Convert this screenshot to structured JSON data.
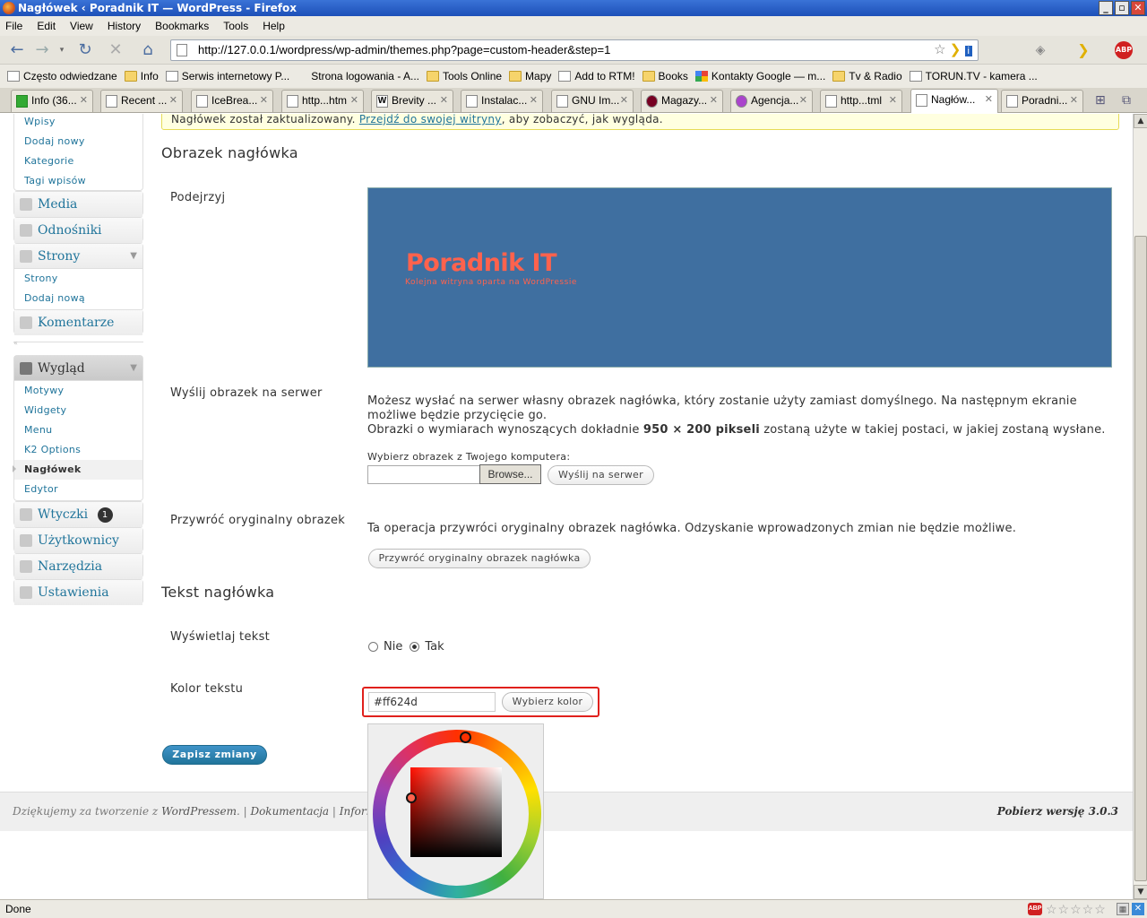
{
  "window": {
    "title": "Nagłówek ‹ Poradnik IT — WordPress - Firefox"
  },
  "menubar": [
    "File",
    "Edit",
    "View",
    "History",
    "Bookmarks",
    "Tools",
    "Help"
  ],
  "address": {
    "url": "http://127.0.0.1/wordpress/wp-admin/themes.php?page=custom-header&step=1"
  },
  "bookmarks": [
    "Często odwiedzane",
    "Info",
    "Serwis internetowy P...",
    "Strona logowania - A...",
    "Tools Online",
    "Mapy",
    "Add to RTM!",
    "Books",
    "Kontakty Google — m...",
    "Tv & Radio",
    "TORUN.TV - kamera ..."
  ],
  "tabs": [
    "Info (36...",
    "Recent ...",
    "IceBrea...",
    "http...htm",
    "Brevity ...",
    "Instalac...",
    "GNU Im...",
    "Magazy...",
    "Agencja...",
    "http...tml",
    "Nagłów...",
    "Poradni..."
  ],
  "notice": {
    "text": "Nagłówek został zaktualizowany.",
    "link": "Przejdź do swojej witryny",
    "rest": ", aby zobaczyć, jak wygląda."
  },
  "sidebar": {
    "posts_sub": [
      "Wpisy",
      "Dodaj nowy",
      "Kategorie",
      "Tagi wpisów"
    ],
    "media": "Media",
    "links": "Odnośniki",
    "pages": "Strony",
    "pages_sub": [
      "Strony",
      "Dodaj nową"
    ],
    "comments": "Komentarze",
    "appearance": "Wygląd",
    "appearance_sub": [
      "Motywy",
      "Widgety",
      "Menu",
      "K2 Options",
      "Nagłówek",
      "Edytor"
    ],
    "plugins": "Wtyczki",
    "plugins_badge": "1",
    "users": "Użytkownicy",
    "tools": "Narzędzia",
    "settings": "Ustawienia"
  },
  "main": {
    "image_heading": "Obrazek nagłówka",
    "preview_label": "Podejrzyj",
    "preview": {
      "site_title": "Poradnik IT",
      "tagline": "Kolejna witryna oparta na WordPressie",
      "bg": "#3f6fa0",
      "text_color": "#ff624d"
    },
    "upload_label": "Wyślij obrazek na serwer",
    "upload_text1": "Możesz wysłać na serwer własny obrazek nagłówka, który zostanie użyty zamiast domyślnego. Na następnym ekranie możliwe będzie przycięcie go.",
    "upload_text2_a": "Obrazki o wymiarach wynoszących dokładnie ",
    "upload_text2_b": "950 × 200 pikseli",
    "upload_text2_c": " zostaną użyte w takiej postaci, w jakiej zostaną wysłane.",
    "choose_file_label": "Wybierz obrazek z Twojego komputera:",
    "browse": "Browse...",
    "upload_button": "Wyślij na serwer",
    "restore_label": "Przywróć oryginalny obrazek",
    "restore_text": "Ta operacja przywróci oryginalny obrazek nagłówka. Odzyskanie wprowadzonych zmian nie będzie możliwe.",
    "restore_button": "Przywróć oryginalny obrazek nagłówka",
    "text_heading": "Tekst nagłówka",
    "display_text_label": "Wyświetlaj tekst",
    "radio_no": "Nie",
    "radio_yes": "Tak",
    "color_label": "Kolor tekstu",
    "color_value": "#ff624d",
    "pick_color": "Wybierz kolor",
    "save": "Zapisz zmiany"
  },
  "footer": {
    "left_a": "Dziękujemy za tworzenie z ",
    "left_wp": "WordPressem",
    "left_b": ". | ",
    "doc": "Dokumentacja",
    "sep": " | ",
    "info": "Informacj",
    "right": "Pobierz wersję 3.0.3"
  },
  "statusbar": {
    "text": "Done"
  },
  "colors": {
    "wp_link": "#21759b",
    "highlight_border": "#e0201c",
    "save_btn": "#2e85bb"
  }
}
